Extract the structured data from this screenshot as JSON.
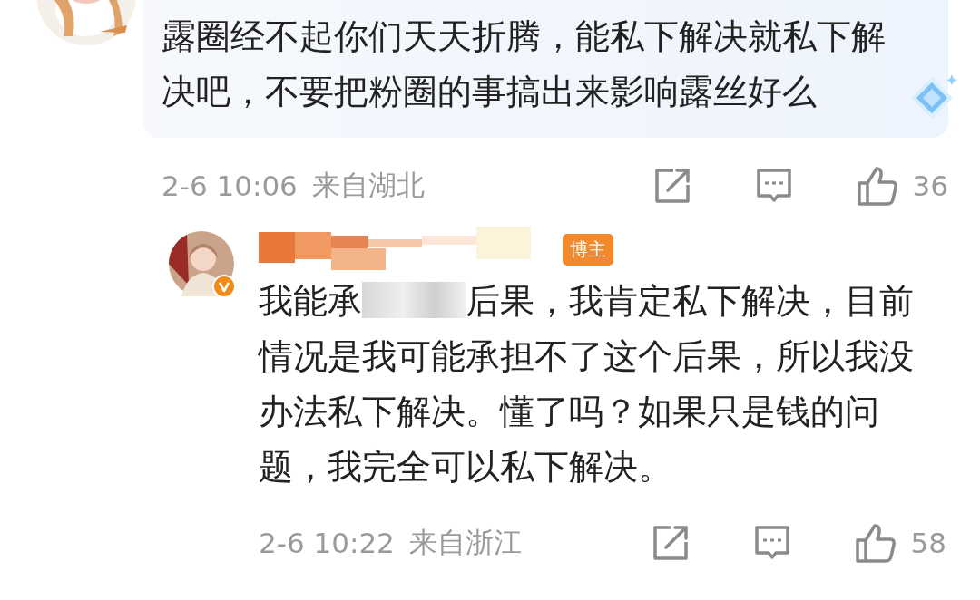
{
  "comments": [
    {
      "highlighted": true,
      "text_parts": [
        "露圈经不起你们天天折腾，能私下解决就私下解决吧，不要把粉圈的事搞出来影响露丝好么"
      ],
      "time": "2-6 10:06",
      "location": "来自湖北",
      "likes": "36"
    },
    {
      "highlighted": false,
      "verified": true,
      "author_badge": "博主",
      "text_parts": [
        "我能承",
        "后果，我肯定私下解决，目前情况是我可能承担不了这个后果，所以我没办法私下解决。懂了吗？如果只是钱的问题，我完全可以私下解决。"
      ],
      "time": "2-6 10:22",
      "location": "来自浙江",
      "likes": "58"
    }
  ]
}
